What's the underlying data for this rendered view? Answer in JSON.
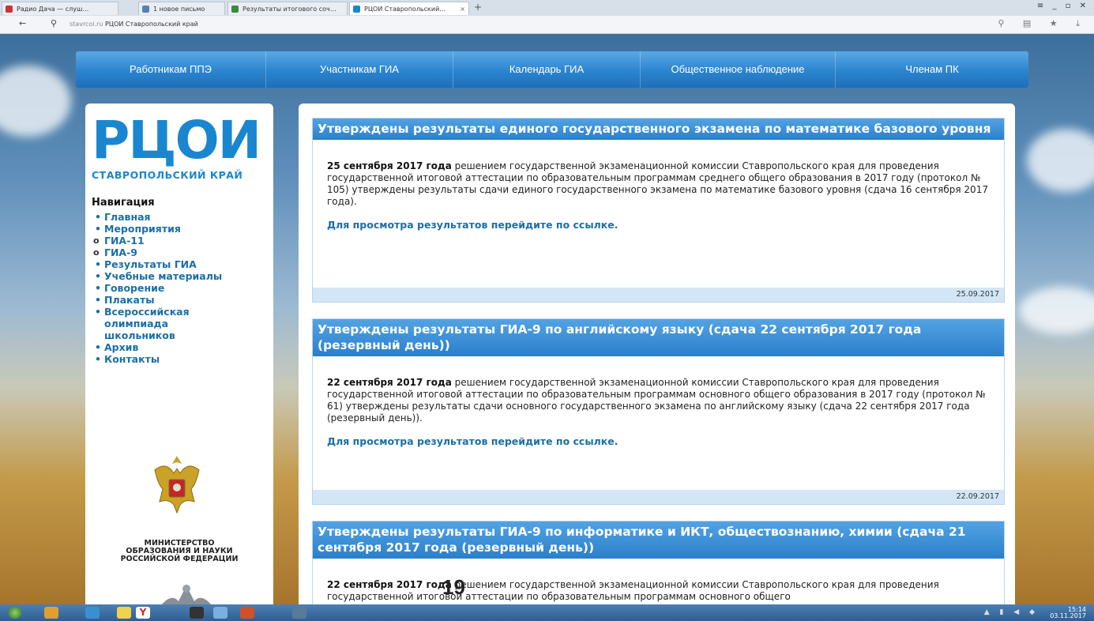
{
  "browser": {
    "tabs": [
      {
        "label": "Радио Дача — слуш…"
      },
      {
        "label": "1 новое письмо"
      },
      {
        "label": "Результаты итогового соч…"
      },
      {
        "label": "РЦОИ Ставропольский…"
      }
    ],
    "new_tab": "+",
    "window_controls": "≡ _ ▫ ✕",
    "back": "←",
    "bookmark": "⚲",
    "url_host": "stavrcoi.ru",
    "url_title": "РЦОИ Ставропольский край",
    "addr_right": "⚲ ▤ ★ ⤓"
  },
  "top_menu": [
    {
      "label": "Работникам ППЭ"
    },
    {
      "label": "Участникам ГИА"
    },
    {
      "label": "Календарь ГИА"
    },
    {
      "label": "Общественное наблюдение"
    },
    {
      "label": "Членам ПК"
    }
  ],
  "sidebar": {
    "logo": "РЦОИ",
    "logo_sub": "СТАВРОПОЛЬСКИЙ КРАЙ",
    "nav_title": "Навигация",
    "nav_items": [
      {
        "label": "Главная",
        "bullet": "•"
      },
      {
        "label": "Мероприятия",
        "bullet": "•"
      },
      {
        "label": "ГИА-11",
        "bullet": "o"
      },
      {
        "label": "ГИА-9",
        "bullet": "o"
      },
      {
        "label": "Результаты ГИА",
        "bullet": "•"
      },
      {
        "label": "Учебные материалы",
        "bullet": "•"
      },
      {
        "label": "Говорение",
        "bullet": "•"
      },
      {
        "label": "Плакаты",
        "bullet": "•"
      },
      {
        "label": "Всероссийская олимпиада школьников",
        "bullet": "•"
      },
      {
        "label": "Архив",
        "bullet": "•"
      },
      {
        "label": "Контакты",
        "bullet": "•"
      }
    ],
    "ministry_lines": [
      "МИНИСТЕРСТВО",
      "ОБРАЗОВАНИЯ И НАУКИ",
      "РОССИЙСКОЙ ФЕДЕРАЦИИ"
    ]
  },
  "articles": [
    {
      "title": "Утверждены результаты единого государственного экзамена по математике базового уровня",
      "date_bold": "25 сентября 2017 года",
      "text": " решением государственной экзаменационной комиссии Ставропольского края для проведения государственной итоговой аттестации по образовательным программам среднего общего образования в 2017 году (протокол № 105) утверждены результаты сдачи единого государственного экзамена по математике базового уровня (сдача 16 сентября 2017 года).",
      "link": "Для просмотра результатов перейдите по ссылке.",
      "date": "25.09.2017"
    },
    {
      "title": "Утверждены результаты ГИА-9 по английскому языку (сдача 22 сентября 2017 года (резервный день))",
      "date_bold": "22 сентября 2017 года",
      "text": " решением государственной экзаменационной комиссии Ставропольского края для проведения государственной итоговой аттестации по образовательным программам основного общего образования в 2017 году (протокол № 61) утверждены результаты сдачи основного государственного экзамена по английскому языку (сдача 22 сентября 2017 года (резервный день)).",
      "link": "Для просмотра результатов перейдите по ссылке.",
      "date": "22.09.2017"
    },
    {
      "title": "Утверждены результаты ГИА-9 по информатике и ИКТ, обществознанию, химии (сдача 21 сентября 2017 года (резервный день))",
      "date_bold": "22 сентября 2017 года",
      "text": " решением государственной экзаменационной комиссии Ставропольского края для проведения государственной итоговой аттестации по образовательным программам основного общего"
    }
  ],
  "slide_number": "19",
  "taskbar": {
    "tray": "▲ ▮ ◀ ◆",
    "time": "15:14",
    "date": "03.11.2017"
  },
  "colors": {
    "menu_blue": "#2b84cf",
    "link_blue": "#1a6fa8",
    "logo_blue": "#1a86d0",
    "date_strip": "#d3e6f5"
  }
}
